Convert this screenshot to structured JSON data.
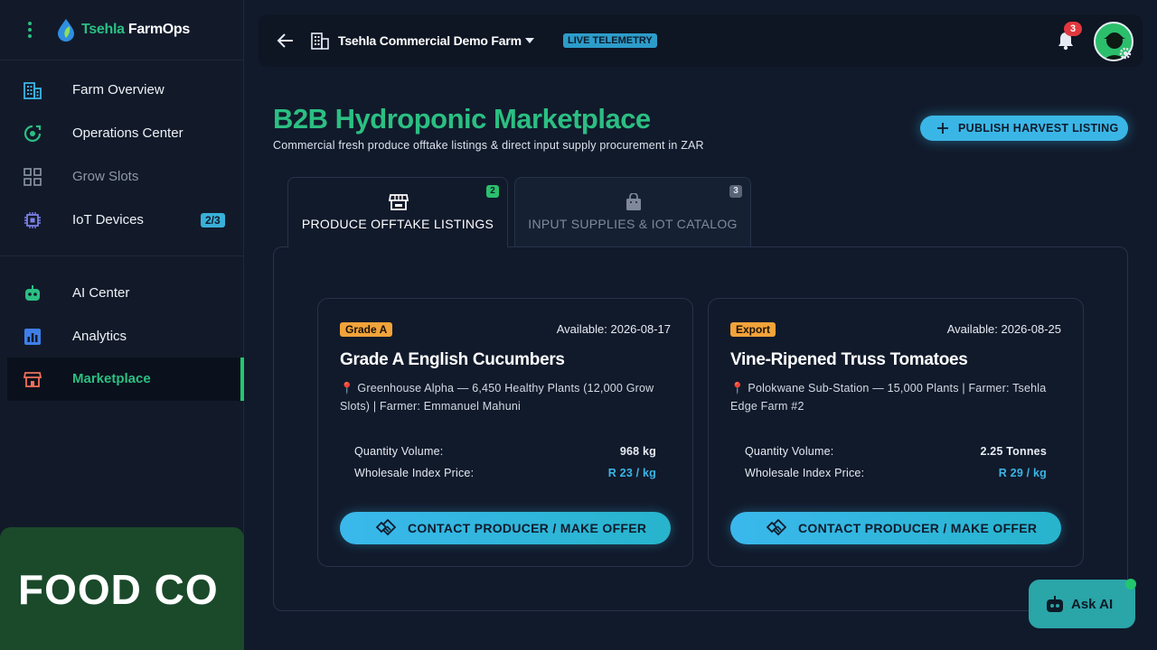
{
  "brand": {
    "name_part1": "Tsehla",
    "name_part2": " FarmOps"
  },
  "sidebar": {
    "items": [
      {
        "label": "Farm Overview",
        "icon": "building-icon"
      },
      {
        "label": "Operations Center",
        "icon": "operations-icon"
      },
      {
        "label": "Grow Slots",
        "icon": "grid-icon"
      },
      {
        "label": "IoT Devices",
        "icon": "chip-icon",
        "badge": "2/3"
      },
      {
        "label": "AI Center",
        "icon": "robot-icon"
      },
      {
        "label": "Analytics",
        "icon": "bar-chart-icon"
      },
      {
        "label": "Marketplace",
        "icon": "store-icon"
      }
    ],
    "promo_text": "FOOD CO"
  },
  "header": {
    "farm_name": "Tsehla Commercial Demo Farm",
    "live_badge": "LIVE TELEMETRY",
    "notification_count": "3"
  },
  "page": {
    "title": "B2B Hydroponic Marketplace",
    "subtitle": "Commercial fresh produce offtake listings & direct input supply procurement in ZAR",
    "publish_label": "PUBLISH HARVEST LISTING"
  },
  "tabs": [
    {
      "label": "PRODUCE OFFTAKE LISTINGS",
      "count": "2"
    },
    {
      "label": "INPUT SUPPLIES & IOT CATALOG",
      "count": "3"
    }
  ],
  "listings": [
    {
      "grade": "Grade A",
      "available": "Available: 2026-08-17",
      "title": "Grade A English Cucumbers",
      "location": "📍 Greenhouse Alpha — 6,450 Healthy Plants (12,000 Grow Slots) | Farmer: Emmanuel Mahuni",
      "qty_label": "Quantity Volume:",
      "qty_value": "968 kg",
      "price_label": "Wholesale Index Price:",
      "price_value": "R 23 / kg",
      "cta": "CONTACT PRODUCER / MAKE OFFER"
    },
    {
      "grade": "Export",
      "available": "Available: 2026-08-25",
      "title": "Vine-Ripened Truss Tomatoes",
      "location": "📍 Polokwane Sub-Station — 15,000 Plants | Farmer: Tsehla Edge Farm #2",
      "qty_label": "Quantity Volume:",
      "qty_value": "2.25 Tonnes",
      "price_label": "Wholesale Index Price:",
      "price_value": "R 29 / kg",
      "cta": "CONTACT PRODUCER / MAKE OFFER"
    }
  ],
  "ask_ai": {
    "label": "Ask AI"
  },
  "colors": {
    "accent_green": "#2bbf82",
    "accent_blue": "#3ab6e6",
    "grade_orange": "#f2a33a",
    "alert_red": "#e0383e"
  }
}
